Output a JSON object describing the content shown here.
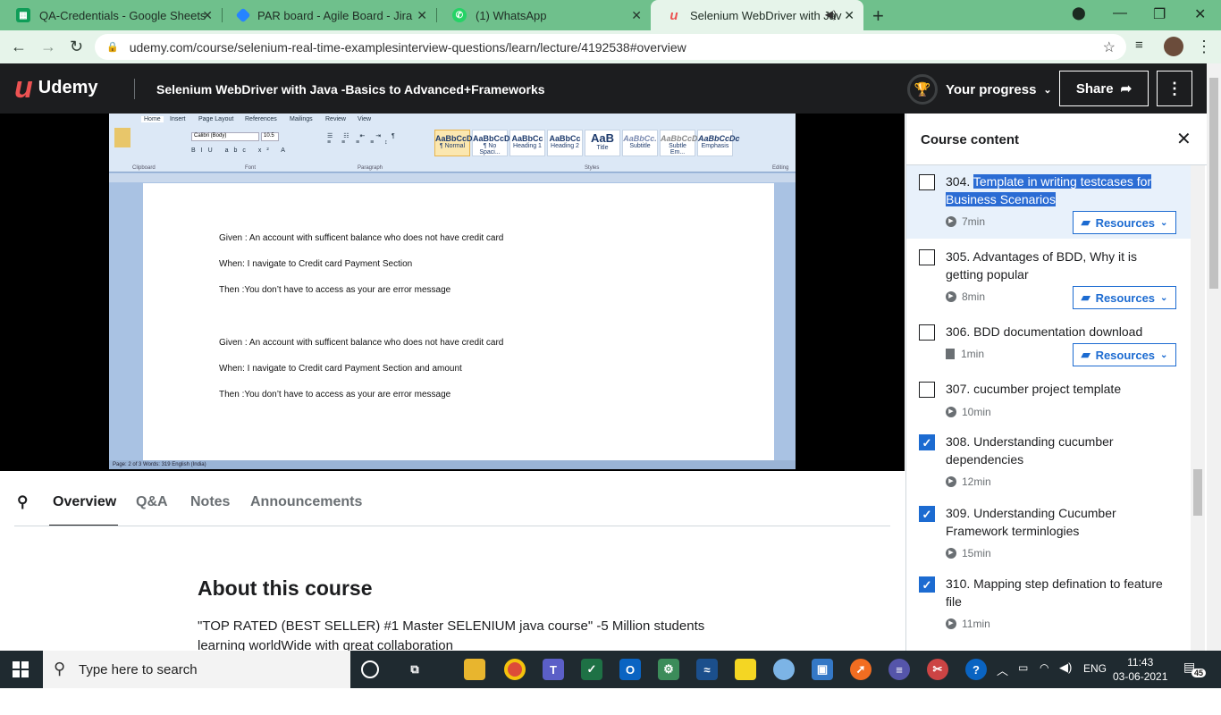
{
  "browser": {
    "tabs": [
      {
        "title": "QA-Credentials - Google Sheets",
        "icon": "sheets-icon",
        "color": "#0f9d58"
      },
      {
        "title": "PAR board - Agile Board - Jira",
        "icon": "jira-icon",
        "color": "#2684ff"
      },
      {
        "title": "(1) WhatsApp",
        "icon": "whatsapp-icon",
        "color": "#25d366"
      },
      {
        "title": "Selenium WebDriver with Jav",
        "icon": "udemy-icon",
        "color": "#ec5252"
      }
    ],
    "url": "udemy.com/course/selenium-real-time-examplesinterview-questions/learn/lecture/4192538#overview"
  },
  "header": {
    "logo": "Udemy",
    "course_title": "Selenium WebDriver with Java -Basics to Advanced+Frameworks",
    "progress_label": "Your progress",
    "share_label": "Share"
  },
  "word_doc": {
    "tabs": [
      "Home",
      "Insert",
      "Page Layout",
      "References",
      "Mailings",
      "Review",
      "View"
    ],
    "font": "Calibri (Body)",
    "font_size": "10.5",
    "styles": [
      {
        "sample": "AaBbCcDc",
        "name": "¶ Normal"
      },
      {
        "sample": "AaBbCcDc",
        "name": "¶ No Spaci..."
      },
      {
        "sample": "AaBbCc",
        "name": "Heading 1"
      },
      {
        "sample": "AaBbCc",
        "name": "Heading 2"
      },
      {
        "sample": "AaB",
        "name": "Title"
      },
      {
        "sample": "AaBbCc.",
        "name": "Subtitle"
      },
      {
        "sample": "AaBbCcDc",
        "name": "Subtle Em..."
      },
      {
        "sample": "AaBbCcDc",
        "name": "Emphasis"
      }
    ],
    "groups": [
      "Clipboard",
      "Font",
      "Paragraph",
      "Styles",
      "Editing"
    ],
    "lines": [
      "Given : An account with sufficent balance who does not have credit card",
      "When: I navigate to Credit card Payment Section",
      "Then  :You don’t have to access as your are error message",
      "Given : An account with sufficent balance who does not have credit card",
      "When: I navigate to Credit card Payment Section  and amount",
      "Then  :You don’t have to access as your are error message"
    ],
    "status": "Page: 2 of 3    Words: 319    English (India)"
  },
  "lecture_tabs": [
    "Overview",
    "Q&A",
    "Notes",
    "Announcements"
  ],
  "about": {
    "title": "About this course",
    "text": "\"TOP RATED (BEST SELLER) #1 Master SELENIUM java course\" -5 Million students learning worldWide with great collaboration"
  },
  "sidebar": {
    "title": "Course content",
    "resources_label": "Resources",
    "lessons": [
      {
        "num": "304.",
        "title": "Template in writing testcases for Business Scenarios",
        "duration": "7min",
        "checked": false,
        "current": true,
        "resources": true,
        "type": "video"
      },
      {
        "num": "305.",
        "title": "Advantages of BDD, Why it is getting popular",
        "duration": "8min",
        "checked": false,
        "current": false,
        "resources": true,
        "type": "video"
      },
      {
        "num": "306.",
        "title": "BDD documentation download",
        "duration": "1min",
        "checked": false,
        "current": false,
        "resources": true,
        "type": "doc"
      },
      {
        "num": "307.",
        "title": "cucumber project template",
        "duration": "10min",
        "checked": false,
        "current": false,
        "resources": false,
        "type": "video"
      },
      {
        "num": "308.",
        "title": "Understanding cucumber dependencies",
        "duration": "12min",
        "checked": true,
        "current": false,
        "resources": false,
        "type": "video"
      },
      {
        "num": "309.",
        "title": "Understanding Cucumber Framework terminlogies",
        "duration": "15min",
        "checked": true,
        "current": false,
        "resources": false,
        "type": "video"
      },
      {
        "num": "310.",
        "title": "Mapping step defination to feature file",
        "duration": "11min",
        "checked": true,
        "current": false,
        "resources": false,
        "type": "video"
      }
    ]
  },
  "taskbar": {
    "search_placeholder": "Type here to search",
    "lang": "ENG",
    "time": "11:43",
    "date": "03-06-2021",
    "notif_count": "45"
  }
}
